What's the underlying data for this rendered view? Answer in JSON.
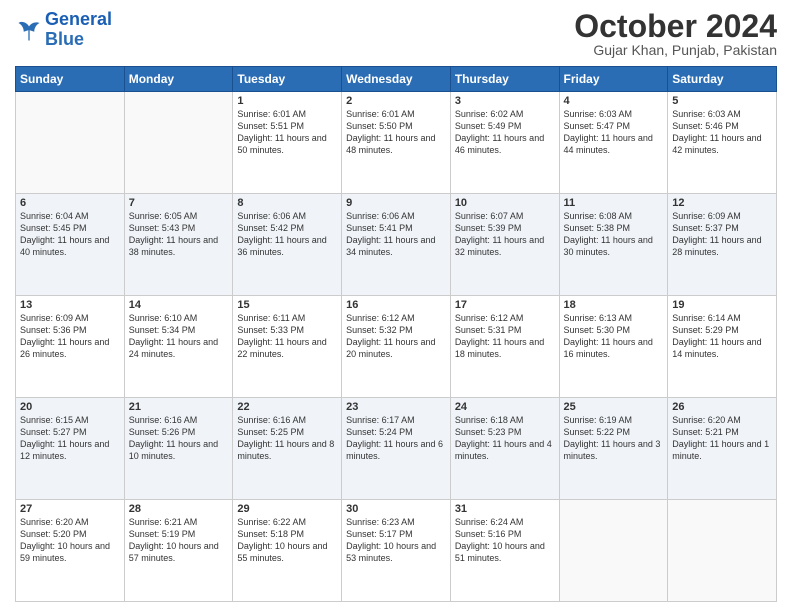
{
  "header": {
    "logo_general": "General",
    "logo_blue": "Blue",
    "month_title": "October 2024",
    "location": "Gujar Khan, Punjab, Pakistan"
  },
  "days_of_week": [
    "Sunday",
    "Monday",
    "Tuesday",
    "Wednesday",
    "Thursday",
    "Friday",
    "Saturday"
  ],
  "weeks": [
    [
      {
        "day": "",
        "content": ""
      },
      {
        "day": "",
        "content": ""
      },
      {
        "day": "1",
        "content": "Sunrise: 6:01 AM\nSunset: 5:51 PM\nDaylight: 11 hours and 50 minutes."
      },
      {
        "day": "2",
        "content": "Sunrise: 6:01 AM\nSunset: 5:50 PM\nDaylight: 11 hours and 48 minutes."
      },
      {
        "day": "3",
        "content": "Sunrise: 6:02 AM\nSunset: 5:49 PM\nDaylight: 11 hours and 46 minutes."
      },
      {
        "day": "4",
        "content": "Sunrise: 6:03 AM\nSunset: 5:47 PM\nDaylight: 11 hours and 44 minutes."
      },
      {
        "day": "5",
        "content": "Sunrise: 6:03 AM\nSunset: 5:46 PM\nDaylight: 11 hours and 42 minutes."
      }
    ],
    [
      {
        "day": "6",
        "content": "Sunrise: 6:04 AM\nSunset: 5:45 PM\nDaylight: 11 hours and 40 minutes."
      },
      {
        "day": "7",
        "content": "Sunrise: 6:05 AM\nSunset: 5:43 PM\nDaylight: 11 hours and 38 minutes."
      },
      {
        "day": "8",
        "content": "Sunrise: 6:06 AM\nSunset: 5:42 PM\nDaylight: 11 hours and 36 minutes."
      },
      {
        "day": "9",
        "content": "Sunrise: 6:06 AM\nSunset: 5:41 PM\nDaylight: 11 hours and 34 minutes."
      },
      {
        "day": "10",
        "content": "Sunrise: 6:07 AM\nSunset: 5:39 PM\nDaylight: 11 hours and 32 minutes."
      },
      {
        "day": "11",
        "content": "Sunrise: 6:08 AM\nSunset: 5:38 PM\nDaylight: 11 hours and 30 minutes."
      },
      {
        "day": "12",
        "content": "Sunrise: 6:09 AM\nSunset: 5:37 PM\nDaylight: 11 hours and 28 minutes."
      }
    ],
    [
      {
        "day": "13",
        "content": "Sunrise: 6:09 AM\nSunset: 5:36 PM\nDaylight: 11 hours and 26 minutes."
      },
      {
        "day": "14",
        "content": "Sunrise: 6:10 AM\nSunset: 5:34 PM\nDaylight: 11 hours and 24 minutes."
      },
      {
        "day": "15",
        "content": "Sunrise: 6:11 AM\nSunset: 5:33 PM\nDaylight: 11 hours and 22 minutes."
      },
      {
        "day": "16",
        "content": "Sunrise: 6:12 AM\nSunset: 5:32 PM\nDaylight: 11 hours and 20 minutes."
      },
      {
        "day": "17",
        "content": "Sunrise: 6:12 AM\nSunset: 5:31 PM\nDaylight: 11 hours and 18 minutes."
      },
      {
        "day": "18",
        "content": "Sunrise: 6:13 AM\nSunset: 5:30 PM\nDaylight: 11 hours and 16 minutes."
      },
      {
        "day": "19",
        "content": "Sunrise: 6:14 AM\nSunset: 5:29 PM\nDaylight: 11 hours and 14 minutes."
      }
    ],
    [
      {
        "day": "20",
        "content": "Sunrise: 6:15 AM\nSunset: 5:27 PM\nDaylight: 11 hours and 12 minutes."
      },
      {
        "day": "21",
        "content": "Sunrise: 6:16 AM\nSunset: 5:26 PM\nDaylight: 11 hours and 10 minutes."
      },
      {
        "day": "22",
        "content": "Sunrise: 6:16 AM\nSunset: 5:25 PM\nDaylight: 11 hours and 8 minutes."
      },
      {
        "day": "23",
        "content": "Sunrise: 6:17 AM\nSunset: 5:24 PM\nDaylight: 11 hours and 6 minutes."
      },
      {
        "day": "24",
        "content": "Sunrise: 6:18 AM\nSunset: 5:23 PM\nDaylight: 11 hours and 4 minutes."
      },
      {
        "day": "25",
        "content": "Sunrise: 6:19 AM\nSunset: 5:22 PM\nDaylight: 11 hours and 3 minutes."
      },
      {
        "day": "26",
        "content": "Sunrise: 6:20 AM\nSunset: 5:21 PM\nDaylight: 11 hours and 1 minute."
      }
    ],
    [
      {
        "day": "27",
        "content": "Sunrise: 6:20 AM\nSunset: 5:20 PM\nDaylight: 10 hours and 59 minutes."
      },
      {
        "day": "28",
        "content": "Sunrise: 6:21 AM\nSunset: 5:19 PM\nDaylight: 10 hours and 57 minutes."
      },
      {
        "day": "29",
        "content": "Sunrise: 6:22 AM\nSunset: 5:18 PM\nDaylight: 10 hours and 55 minutes."
      },
      {
        "day": "30",
        "content": "Sunrise: 6:23 AM\nSunset: 5:17 PM\nDaylight: 10 hours and 53 minutes."
      },
      {
        "day": "31",
        "content": "Sunrise: 6:24 AM\nSunset: 5:16 PM\nDaylight: 10 hours and 51 minutes."
      },
      {
        "day": "",
        "content": ""
      },
      {
        "day": "",
        "content": ""
      }
    ]
  ]
}
